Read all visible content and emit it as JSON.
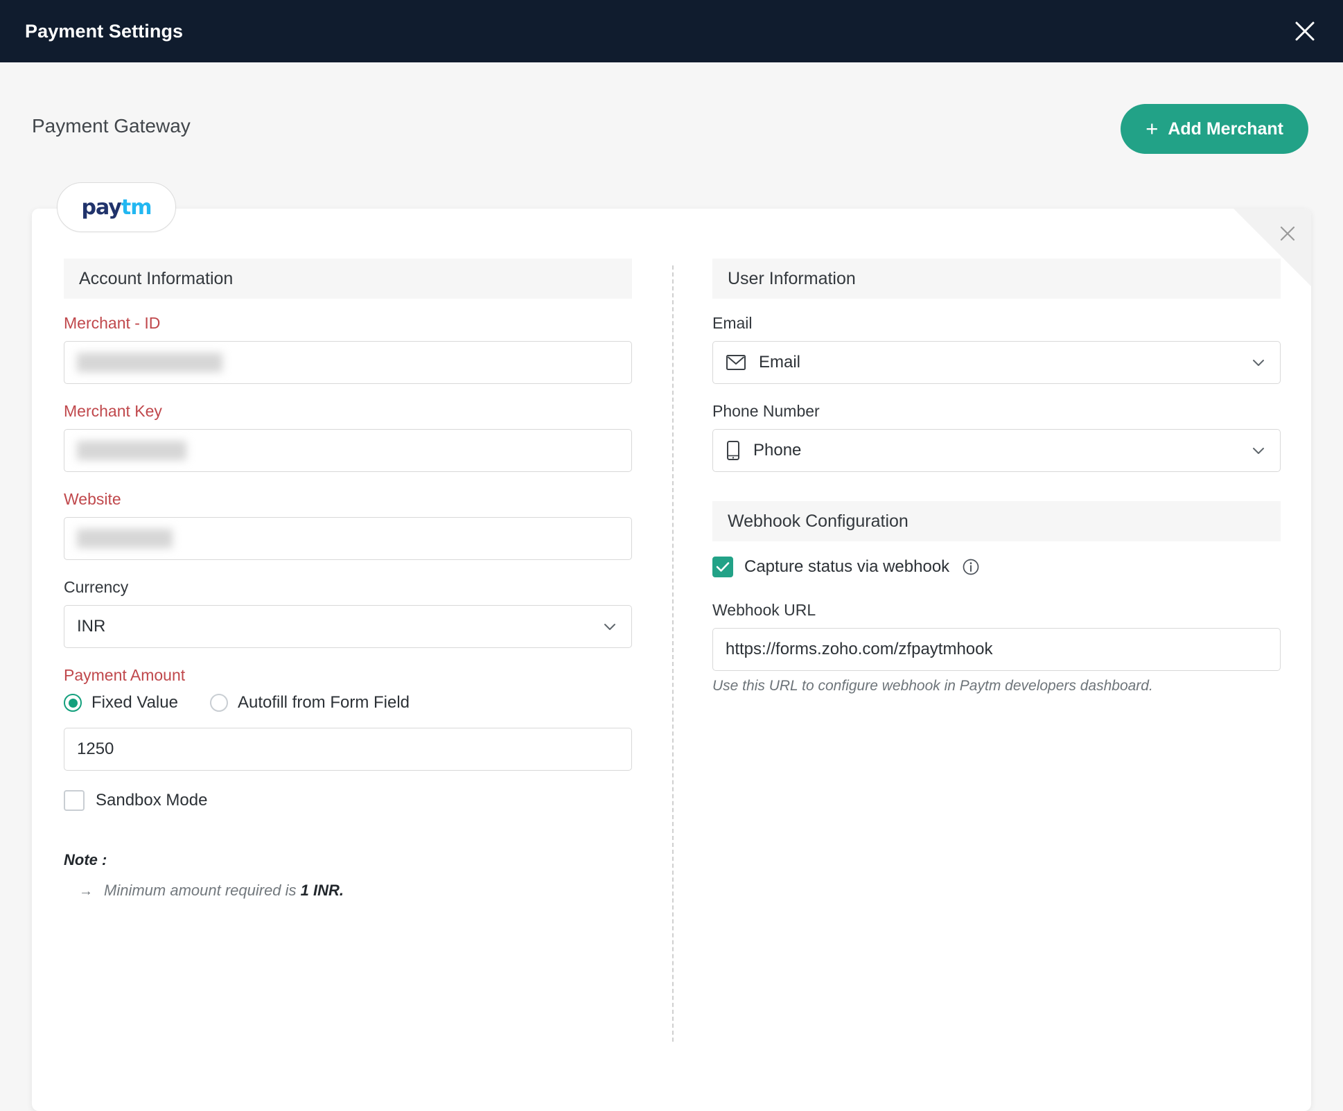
{
  "window": {
    "title": "Payment Settings",
    "close_icon": "close-icon"
  },
  "header": {
    "title": "Payment Gateway",
    "add_merchant_label": "Add Merchant",
    "add_merchant_plus": "+"
  },
  "tabs": [
    {
      "id": "paytm",
      "logo_part1": "pay",
      "logo_part2": "tm",
      "active": true
    }
  ],
  "card": {
    "close_icon": "close-icon"
  },
  "account_information": {
    "section_title": "Account Information",
    "merchant_id": {
      "label": "Merchant - ID",
      "value": "",
      "redacted": true,
      "required": true
    },
    "merchant_key": {
      "label": "Merchant Key",
      "value": "",
      "redacted": true,
      "required": true
    },
    "website": {
      "label": "Website",
      "value": "",
      "redacted": true,
      "required": true
    },
    "currency": {
      "label": "Currency",
      "value": "INR",
      "required": false
    },
    "payment_amount": {
      "label": "Payment Amount",
      "required": true,
      "options": [
        {
          "label": "Fixed Value",
          "selected": true
        },
        {
          "label": "Autofill from Form Field",
          "selected": false
        }
      ],
      "amount_value": "1250",
      "amount_placeholder": ""
    },
    "sandbox_mode": {
      "label": "Sandbox Mode",
      "checked": false
    },
    "note": {
      "title": "Note :",
      "arrow": "→",
      "items": [
        {
          "text": "Minimum amount required is ",
          "emphasis": "1 INR."
        }
      ]
    }
  },
  "user_information": {
    "section_title": "User Information",
    "email": {
      "label": "Email",
      "value": "Email",
      "icon": "envelope-icon"
    },
    "phone": {
      "label": "Phone Number",
      "value": "Phone",
      "icon": "mobile-phone-icon"
    }
  },
  "webhook_configuration": {
    "section_title": "Webhook Configuration",
    "capture_status": {
      "label": "Capture status via webhook",
      "checked": true,
      "info_icon": "info-icon"
    },
    "webhook_url": {
      "label": "Webhook URL",
      "value": "https://forms.zoho.com/zfpaytmhook",
      "helper": "Use this URL to configure webhook in Paytm developers dashboard."
    }
  },
  "colors": {
    "titlebar_bg": "#101c2e",
    "accent_green": "#22a287",
    "radio_green": "#14a07d",
    "required_red": "#c0484c",
    "page_bg": "#f6f6f6",
    "paytm_dark": "#20336b",
    "paytm_light": "#22b7f1"
  }
}
